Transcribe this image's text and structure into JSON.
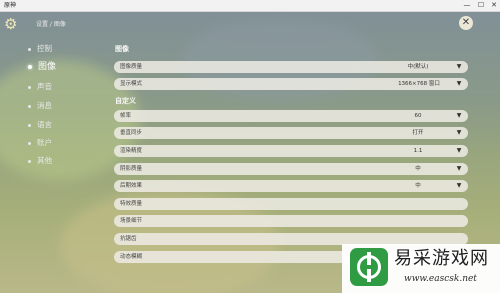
{
  "window": {
    "title": "原神",
    "minimize": "—",
    "maximize": "☐",
    "close": "✕"
  },
  "header": {
    "breadcrumb": "设置 / 图像",
    "gear_icon": "gear-icon",
    "close_icon": "close-icon",
    "close_glyph": "✕",
    "gear_glyph": "⚙"
  },
  "sidebar": {
    "items": [
      {
        "label": "控制"
      },
      {
        "label": "图像"
      },
      {
        "label": "声音"
      },
      {
        "label": "消息"
      },
      {
        "label": "语言"
      },
      {
        "label": "账户"
      },
      {
        "label": "其他"
      }
    ],
    "active_index": 1
  },
  "sections": {
    "image": "图像",
    "custom": "自定义"
  },
  "image_rows": [
    {
      "label": "图像质量",
      "value": "中(默认)",
      "arrow": "▼"
    },
    {
      "label": "显示模式",
      "value": "1366×768 窗口",
      "arrow": "▼"
    }
  ],
  "custom_rows": [
    {
      "label": "帧率",
      "value": "60",
      "arrow": "▼"
    },
    {
      "label": "垂直同步",
      "value": "打开",
      "arrow": "▼"
    },
    {
      "label": "渲染精度",
      "value": "1.1",
      "arrow": "▼"
    },
    {
      "label": "阴影质量",
      "value": "中",
      "arrow": "▼"
    },
    {
      "label": "后期效果",
      "value": "中",
      "arrow": "▼"
    },
    {
      "label": "特效质量",
      "value": "",
      "arrow": ""
    },
    {
      "label": "场景细节",
      "value": "",
      "arrow": ""
    },
    {
      "label": "抗锯齿",
      "value": "",
      "arrow": ""
    },
    {
      "label": "动态模糊",
      "value": "",
      "arrow": ""
    }
  ],
  "watermark": {
    "title": "易采游戏网",
    "url": "www.eascsk.net",
    "accent": "#2f9b43"
  }
}
